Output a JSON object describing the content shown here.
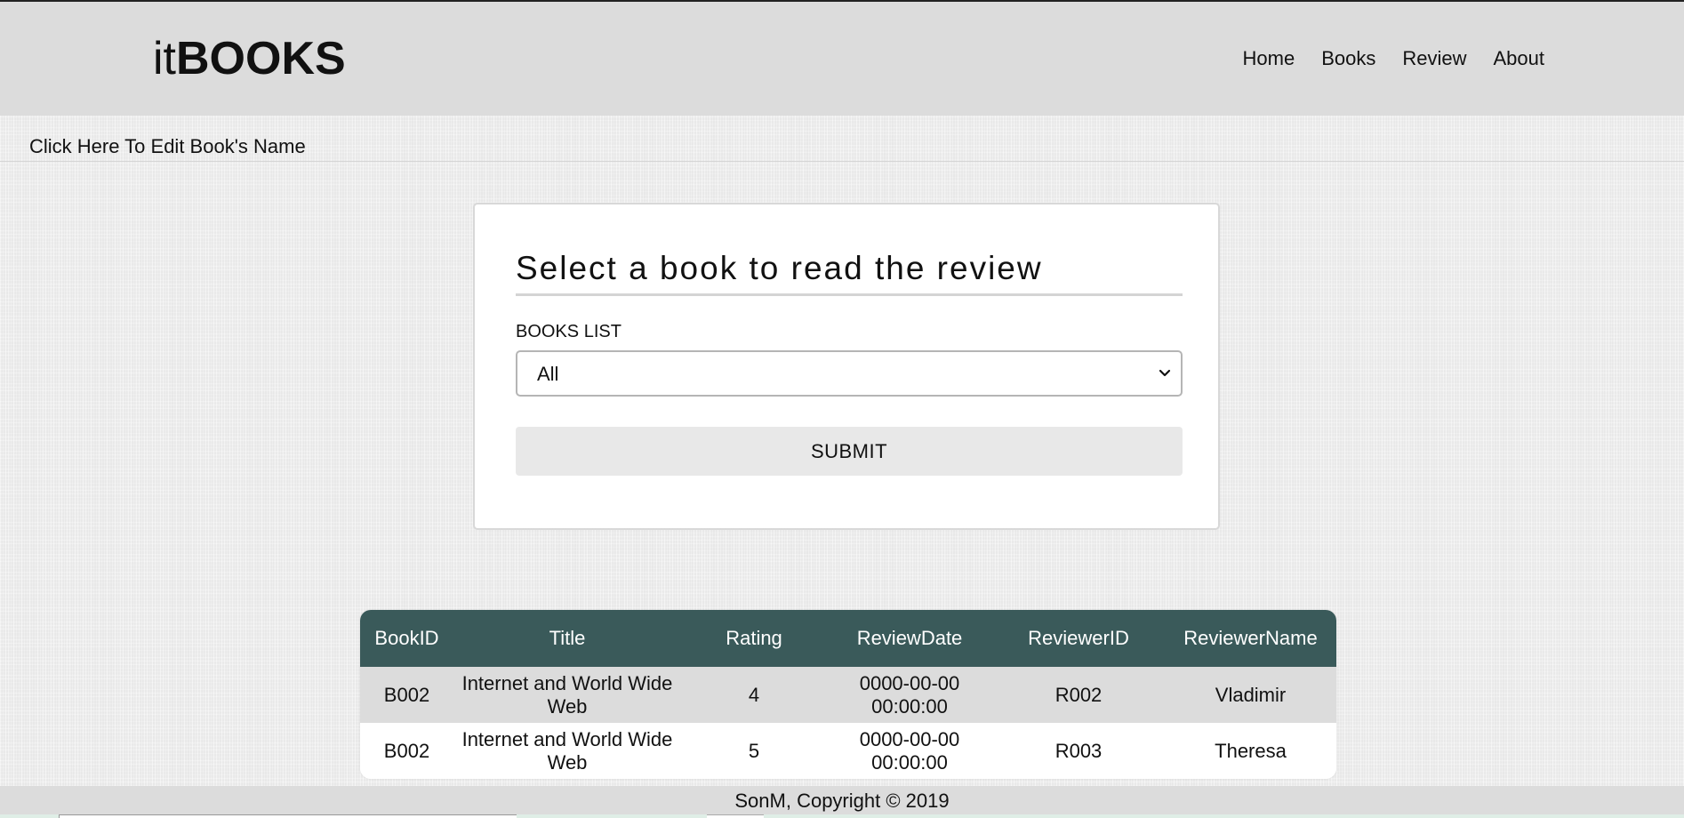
{
  "header": {
    "brand_prefix": "it",
    "brand_bold": "BOOKS",
    "nav": [
      {
        "label": "Home"
      },
      {
        "label": "Books"
      },
      {
        "label": "Review"
      },
      {
        "label": "About"
      }
    ]
  },
  "edit_link": "Click Here To Edit Book's Name",
  "card": {
    "title": "Select a book to read the review",
    "list_label": "BOOKS LIST",
    "selected_option": "All",
    "submit_label": "SUBMIT"
  },
  "table": {
    "headers": [
      "BookID",
      "Title",
      "Rating",
      "ReviewDate",
      "ReviewerID",
      "ReviewerName"
    ],
    "rows": [
      [
        "B002",
        "Internet and World Wide Web",
        "4",
        "0000-00-00 00:00:00",
        "R002",
        "Vladimir"
      ],
      [
        "B002",
        "Internet and World Wide Web",
        "5",
        "0000-00-00 00:00:00",
        "R003",
        "Theresa"
      ]
    ]
  },
  "footer": {
    "text": "SonM, Copyright © 2019"
  },
  "colors": {
    "header_bg": "#dcdcdc",
    "table_header_bg": "#3a5a5a",
    "row_alt_bg": "#dcdcdc",
    "submit_bg": "#e8e8e8"
  }
}
